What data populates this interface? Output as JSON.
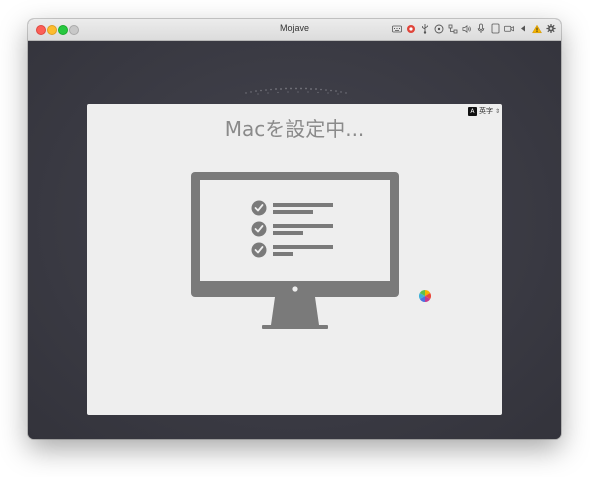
{
  "window": {
    "title": "Mojave"
  },
  "toolbar": {
    "icons": [
      "keyboard-icon",
      "record-icon",
      "usb-icon",
      "disc-icon",
      "network-icon",
      "speaker-icon",
      "microphone-icon",
      "display-icon",
      "camera-icon",
      "back-arrow-icon",
      "warning-icon",
      "settings-gear-icon"
    ]
  },
  "setup": {
    "heading": "Macを設定中...",
    "input_source": {
      "badge": "A",
      "label": "英字"
    }
  },
  "colors": {
    "panel": "#eeeeee",
    "desktop": "#3a3a43",
    "icon_gray": "#7a7a7a",
    "heading": "#8a8a8a"
  }
}
